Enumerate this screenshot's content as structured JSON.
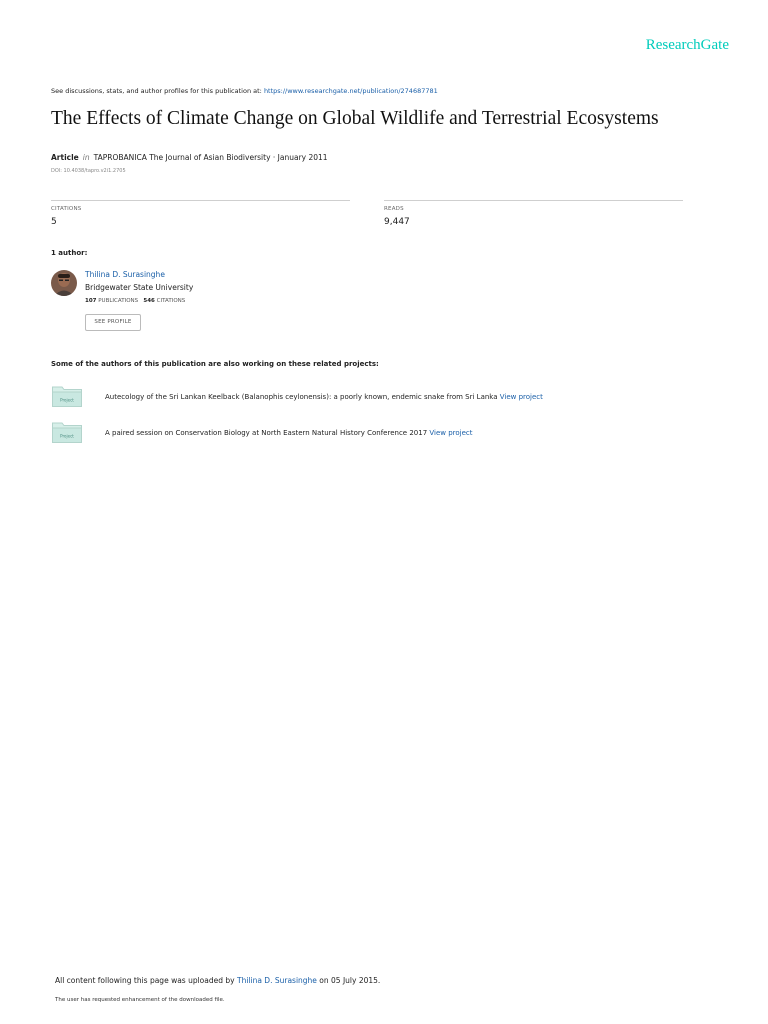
{
  "brand": {
    "logo_text": "ResearchGate",
    "accent_color": "#00ccbb",
    "link_color": "#1a5fa8"
  },
  "header": {
    "discussion_text": "See discussions, stats, and author profiles for this publication at: ",
    "publication_url": "https://www.researchgate.net/publication/274687781"
  },
  "article": {
    "title": "The Effects of Climate Change on Global Wildlife and Terrestrial Ecosystems",
    "type": "Article",
    "in_word": "in",
    "journal_and_date": "TAPROBANICA The Journal of Asian Biodiversity · January 2011",
    "doi": "DOI: 10.4038/tapro.v2i1.2705"
  },
  "stats": {
    "citations": {
      "label": "CITATIONS",
      "value": "5"
    },
    "reads": {
      "label": "READS",
      "value": "9,447"
    }
  },
  "authors": {
    "heading": "1 author:",
    "list": [
      {
        "name": "Thilina D. Surasinghe",
        "institution": "Bridgewater State University",
        "publications_count": "107",
        "publications_label": "PUBLICATIONS",
        "citations_count": "546",
        "citations_label": "CITATIONS",
        "button_label": "SEE PROFILE"
      }
    ]
  },
  "related": {
    "heading": "Some of the authors of this publication are also working on these related projects:",
    "projects": [
      {
        "icon_label": "Project",
        "text": "Autecology of the Sri Lankan Keelback (Balanophis ceylonensis): a poorly known, endemic snake from Sri Lanka ",
        "link": "View project"
      },
      {
        "icon_label": "Project",
        "text": "A paired session on Conservation Biology at North Eastern Natural History Conference 2017 ",
        "link": "View project"
      }
    ]
  },
  "footer": {
    "uploaded_prefix": "All content following this page was uploaded by ",
    "uploader": "Thilina D. Surasinghe",
    "uploaded_suffix": " on 05 July 2015.",
    "note": "The user has requested enhancement of the downloaded file."
  }
}
